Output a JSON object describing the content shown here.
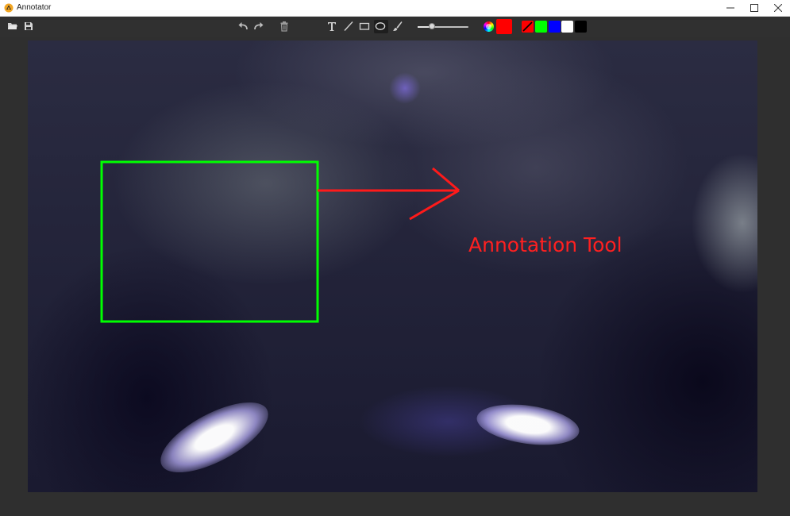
{
  "window": {
    "title": "Annotator",
    "controls": [
      "minimize",
      "maximize",
      "close"
    ]
  },
  "toolbar": {
    "file_tools": [
      "open-folder-icon",
      "save-icon"
    ],
    "edit_tools": [
      "undo-icon",
      "redo-icon",
      "delete-icon"
    ],
    "draw_tools": [
      "text-tool-icon",
      "line-tool-icon",
      "rectangle-tool-icon",
      "ellipse-tool-icon",
      "brush-tool-icon"
    ],
    "selected_tool": "ellipse",
    "stroke_width_level": 0.28,
    "current_color": "#ff0000",
    "palette": [
      {
        "name": "none",
        "color": "#ff0000"
      },
      {
        "name": "green",
        "color": "#00ff00"
      },
      {
        "name": "blue",
        "color": "#0000ff"
      },
      {
        "name": "white",
        "color": "#ffffff"
      },
      {
        "name": "black",
        "color": "#000000"
      }
    ]
  },
  "canvas": {
    "annotations": {
      "rectangle_color": "#00ff00",
      "arrow_color": "#ff1a1a",
      "text": "Annotation Tool",
      "text_color": "#ff2020"
    }
  }
}
